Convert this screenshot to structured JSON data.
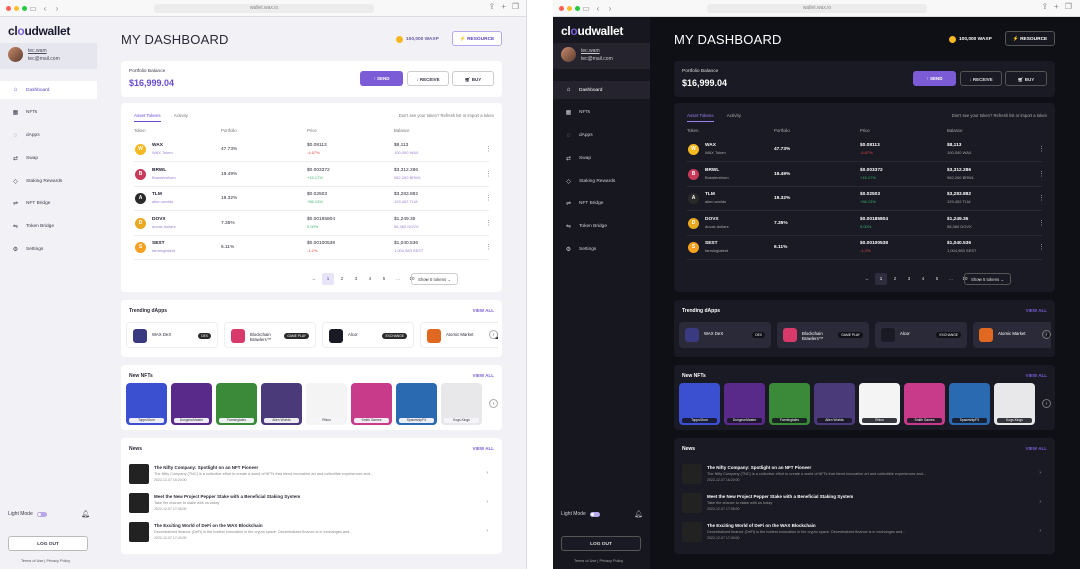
{
  "browser": {
    "url": "wallet.wax.io",
    "light": "light",
    "dark": "dark"
  },
  "logo": {
    "prefix": "cl",
    "accent": "o",
    "suffix": "udwallet"
  },
  "user": {
    "name": "tec.wam",
    "email": "tec@mail.com"
  },
  "nav": [
    {
      "label": "Dashboard",
      "icon": "home-icon"
    },
    {
      "label": "NFTs",
      "icon": "nft-icon"
    },
    {
      "label": "dApps",
      "icon": "apps-icon"
    },
    {
      "label": "Swap",
      "icon": "swap-icon"
    },
    {
      "label": "Staking Rewards",
      "icon": "staking-icon"
    },
    {
      "label": "NFT Bridge",
      "icon": "bridge-icon"
    },
    {
      "label": "Token Bridge",
      "icon": "token-bridge-icon"
    },
    {
      "label": "Settings",
      "icon": "gear-icon"
    }
  ],
  "sidebar": {
    "light_mode": "Light Mode",
    "logout": "LOG OUT",
    "terms": "Terms of Use",
    "privacy": "Privacy Policy"
  },
  "header": {
    "title": "MY DASHBOARD",
    "wax_balance": "100,000 WAXP",
    "resource": "RESOURCE"
  },
  "portfolio": {
    "label": "Portfolio Balance",
    "value": "$16,999.04",
    "send": "SEND",
    "receive": "RECEIVE",
    "buy": "BUY"
  },
  "assets": {
    "tabs": [
      "Asset Tokens",
      "Activity"
    ],
    "hint": "Don't see your token? Refresh list or import a token",
    "columns": [
      "Token",
      "Portfolio",
      "Price",
      "Balance"
    ],
    "rows": [
      {
        "sym": "WAX",
        "name": "WAX Token",
        "pct": "47.73%",
        "price": "$0.08113",
        "chg": "-4.67%",
        "dir": "dn",
        "bal": "$8,113",
        "bsub": "100,000 WAX",
        "color": "#f5b820",
        "glyph": "W"
      },
      {
        "sym": "BRWL",
        "name": "Brawlersfrom",
        "pct": "19.49%",
        "price": "$0.003372",
        "chg": "+15.17%",
        "dir": "up",
        "bal": "$3,312.286",
        "bsub": "982,200 BRWL",
        "color": "#c83a5a",
        "glyph": "B"
      },
      {
        "sym": "TLM",
        "name": "alien.worlds",
        "pct": "19.32%",
        "price": "$0.02503",
        "chg": "+56.13%",
        "dir": "up",
        "bal": "$3,283.882",
        "bsub": "129,402 TLM",
        "color": "#2a2a2a",
        "glyph": "A"
      },
      {
        "sym": "DOVX",
        "name": "dovax.dollars",
        "pct": "7.35%",
        "price": "$0.00185804",
        "chg": "0.00%",
        "dir": "up",
        "bal": "$1,249.35",
        "bsub": "58,360 DOVX",
        "color": "#e8a820",
        "glyph": "D"
      },
      {
        "sym": "SEST",
        "name": "farmingtalent",
        "pct": "6.11%",
        "price": "$0.00100538",
        "chg": "-1.2%",
        "dir": "dn",
        "bal": "$1,040.536",
        "bsub": "1,004,983 SEST",
        "color": "#f5a020",
        "glyph": "S"
      }
    ],
    "pages": [
      "←",
      "1",
      "2",
      "3",
      "4",
      "5",
      "...",
      "10",
      "→"
    ],
    "show": "Show 5 tokens ⌄"
  },
  "trending": {
    "title": "Trending dApps",
    "view_all": "VIEW ALL",
    "items": [
      {
        "name": "WAX DeX",
        "tag": "DEX",
        "color": "#3a3a80"
      },
      {
        "name": "Blockchain Brawlers™",
        "tag": "GAME PLAY",
        "color": "#d8386a"
      },
      {
        "name": "Alcor",
        "tag": "EXCHANGE",
        "color": "#1a1a24"
      },
      {
        "name": "Atomic Market",
        "tag": "NFT",
        "color": "#e06820"
      }
    ]
  },
  "nfts": {
    "title": "New NFTs",
    "view_all": "VIEW ALL",
    "items": [
      {
        "name": "Topps/Gum",
        "bg": "#3a50d0"
      },
      {
        "name": "DungeonMaster",
        "bg": "#5a2a8a"
      },
      {
        "name": "Farmingtales",
        "bg": "#3a8a3a"
      },
      {
        "name": "Alien Worlds",
        "bg": "#4a3a7a"
      },
      {
        "name": "Rhino",
        "bg": "#f4f4f4"
      },
      {
        "name": "Smith Games",
        "bg": "#c83a8a"
      },
      {
        "name": "SpaceshipFX",
        "bg": "#2a6ab0"
      },
      {
        "name": "Kogs.Kings",
        "bg": "#e8e8ea"
      }
    ]
  },
  "news": {
    "title": "News",
    "view_all": "VIEW ALL",
    "items": [
      {
        "title": "The Nifty Company: Spotlight on an NFT Pioneer",
        "text": "The Nifty Company (TNC) is a collective effort to create a world of NFTs that blend innovative art and collectible experiences and...",
        "date": "2022-12-07 16:20:00"
      },
      {
        "title": "Meet the New Project Pepper Stake with a Beneficial Staking System",
        "text": "Take the chance to stake with us today",
        "date": "2022-12-07 17:05:00"
      },
      {
        "title": "The Exciting World of DeFi on the WAX Blockchain",
        "text": "Decentralized finance (DeFi) is the hottest innovation in the crypto space. Decentralized finance is in exchanges and...",
        "date": "2022-12-07 17:40:00"
      }
    ]
  }
}
